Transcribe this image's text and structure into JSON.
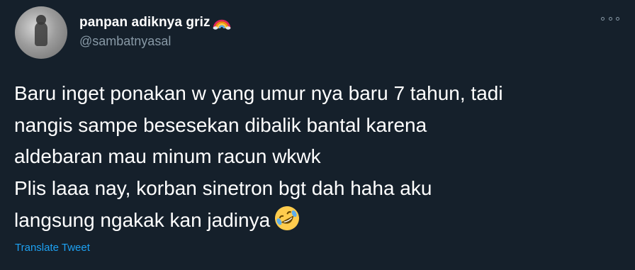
{
  "tweet": {
    "author": {
      "display_name": "panpan adiknya griz",
      "name_emoji": "rainbow-icon",
      "handle": "@sambatnyasal"
    },
    "text_lines": [
      "Baru inget ponakan w yang umur nya baru 7 tahun, tadi",
      "nangis sampe besesekan dibalik bantal karena",
      "aldebaran mau minum racun wkwk",
      "Plis laaa nay, korban sinetron bgt dah haha aku",
      "langsung ngakak kan jadinya"
    ],
    "end_emoji": "rolling-on-floor-laughing-icon",
    "translate_label": "Translate Tweet"
  },
  "colors": {
    "background": "#15202b",
    "text": "#ffffff",
    "secondary": "#8899a6",
    "link": "#1da1f2"
  }
}
